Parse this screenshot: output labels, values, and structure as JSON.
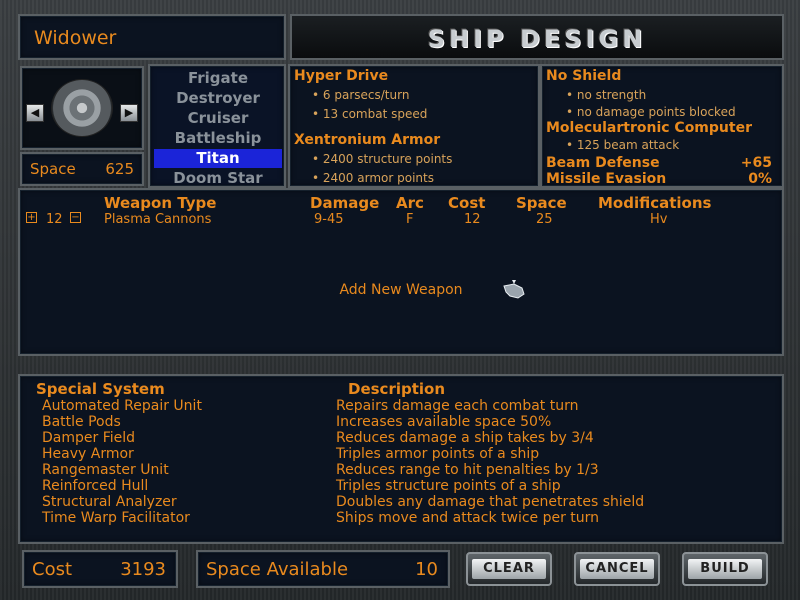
{
  "header": {
    "ship_name": "Widower",
    "title": "SHIP DESIGN"
  },
  "ship": {
    "space_label": "Space",
    "space_value": "625"
  },
  "hulls": [
    {
      "label": "Frigate",
      "selected": false
    },
    {
      "label": "Destroyer",
      "selected": false
    },
    {
      "label": "Cruiser",
      "selected": false
    },
    {
      "label": "Battleship",
      "selected": false
    },
    {
      "label": "Titan",
      "selected": true
    },
    {
      "label": "Doom Star",
      "selected": false
    }
  ],
  "drive": {
    "title": "Hyper Drive",
    "details": [
      "6 parsecs/turn",
      "13 combat speed"
    ]
  },
  "armor": {
    "title": "Xentronium Armor",
    "details": [
      "2400 structure points",
      "2400 armor points"
    ]
  },
  "shield": {
    "title": "No Shield",
    "details": [
      "no strength",
      "no damage points blocked"
    ]
  },
  "computer": {
    "title": "Moleculartronic Computer",
    "details": [
      "125 beam attack"
    ]
  },
  "stats": {
    "beam_defense_label": "Beam Defense",
    "beam_defense_value": "+65",
    "missile_evasion_label": "Missile Evasion",
    "missile_evasion_value": "0%"
  },
  "weapons": {
    "headers": {
      "type": "Weapon Type",
      "damage": "Damage",
      "arc": "Arc",
      "cost": "Cost",
      "space": "Space",
      "mods": "Modifications"
    },
    "rows": [
      {
        "count": "12",
        "type": "Plasma Cannons",
        "damage": "9-45",
        "arc": "F",
        "cost": "12",
        "space": "25",
        "mods": "Hv"
      }
    ],
    "add_label": "Add New Weapon"
  },
  "specials": {
    "headers": {
      "system": "Special System",
      "description": "Description"
    },
    "items": [
      {
        "name": "Automated Repair Unit",
        "desc": "Repairs damage each combat turn"
      },
      {
        "name": "Battle Pods",
        "desc": "Increases available space 50%"
      },
      {
        "name": "Damper Field",
        "desc": "Reduces damage a ship takes by 3/4"
      },
      {
        "name": "Heavy Armor",
        "desc": "Triples armor points of a ship"
      },
      {
        "name": "Rangemaster Unit",
        "desc": "Reduces range to hit penalties by 1/3"
      },
      {
        "name": "Reinforced Hull",
        "desc": "Triples structure points of a ship"
      },
      {
        "name": "Structural Analyzer",
        "desc": "Doubles any damage that penetrates shield"
      },
      {
        "name": "Time Warp Facilitator",
        "desc": "Ships move and attack twice per turn"
      }
    ]
  },
  "footer": {
    "cost_label": "Cost",
    "cost_value": "3193",
    "space_available_label": "Space Available",
    "space_available_value": "10",
    "clear_label": "CLEAR",
    "cancel_label": "CANCEL",
    "build_label": "BUILD"
  },
  "colors": {
    "accent": "#e98a1e",
    "selection": "#1b24d8",
    "panel": "#0b1320"
  }
}
